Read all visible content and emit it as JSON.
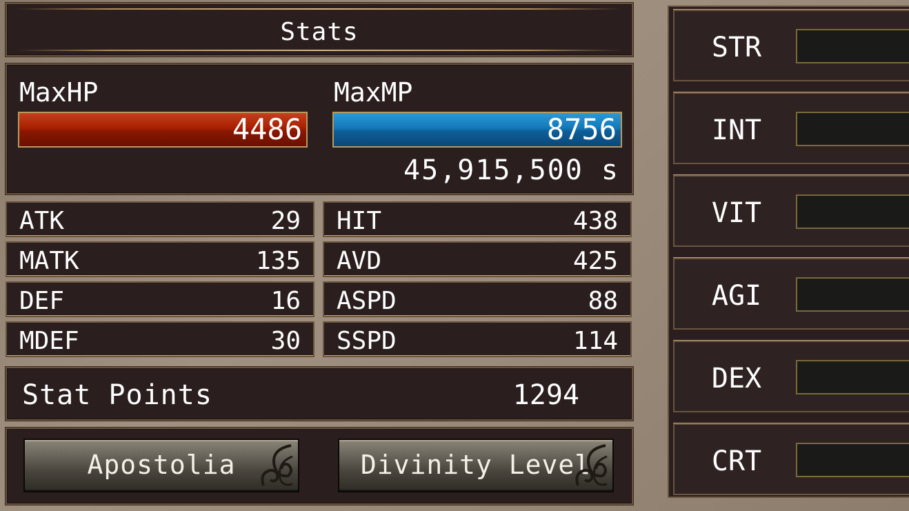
{
  "title": "Stats",
  "hp": {
    "label": "MaxHP",
    "value": "4486"
  },
  "mp": {
    "label": "MaxMP",
    "value": "8756"
  },
  "currency": "45,915,500 s",
  "stats_left": [
    {
      "name": "ATK",
      "value": "29"
    },
    {
      "name": "MATK",
      "value": "135"
    },
    {
      "name": "DEF",
      "value": "16"
    },
    {
      "name": "MDEF",
      "value": "30"
    }
  ],
  "stats_right": [
    {
      "name": "HIT",
      "value": "438"
    },
    {
      "name": "AVD",
      "value": "425"
    },
    {
      "name": "ASPD",
      "value": "88"
    },
    {
      "name": "SSPD",
      "value": "114"
    }
  ],
  "stat_points": {
    "label": "Stat Points",
    "value": "1294"
  },
  "buttons": {
    "apostolia": "Apostolia",
    "divinity": "Divinity Level"
  },
  "attributes": [
    {
      "name": "STR"
    },
    {
      "name": "INT"
    },
    {
      "name": "VIT"
    },
    {
      "name": "AGI"
    },
    {
      "name": "DEX"
    },
    {
      "name": "CRT"
    }
  ],
  "colors": {
    "hp_bar": "#a82000",
    "mp_bar": "#1478b8",
    "panel": "#2a1f1e",
    "border": "#6b5540"
  },
  "icons": {
    "button_decoration": "swirl-ornament-icon"
  }
}
